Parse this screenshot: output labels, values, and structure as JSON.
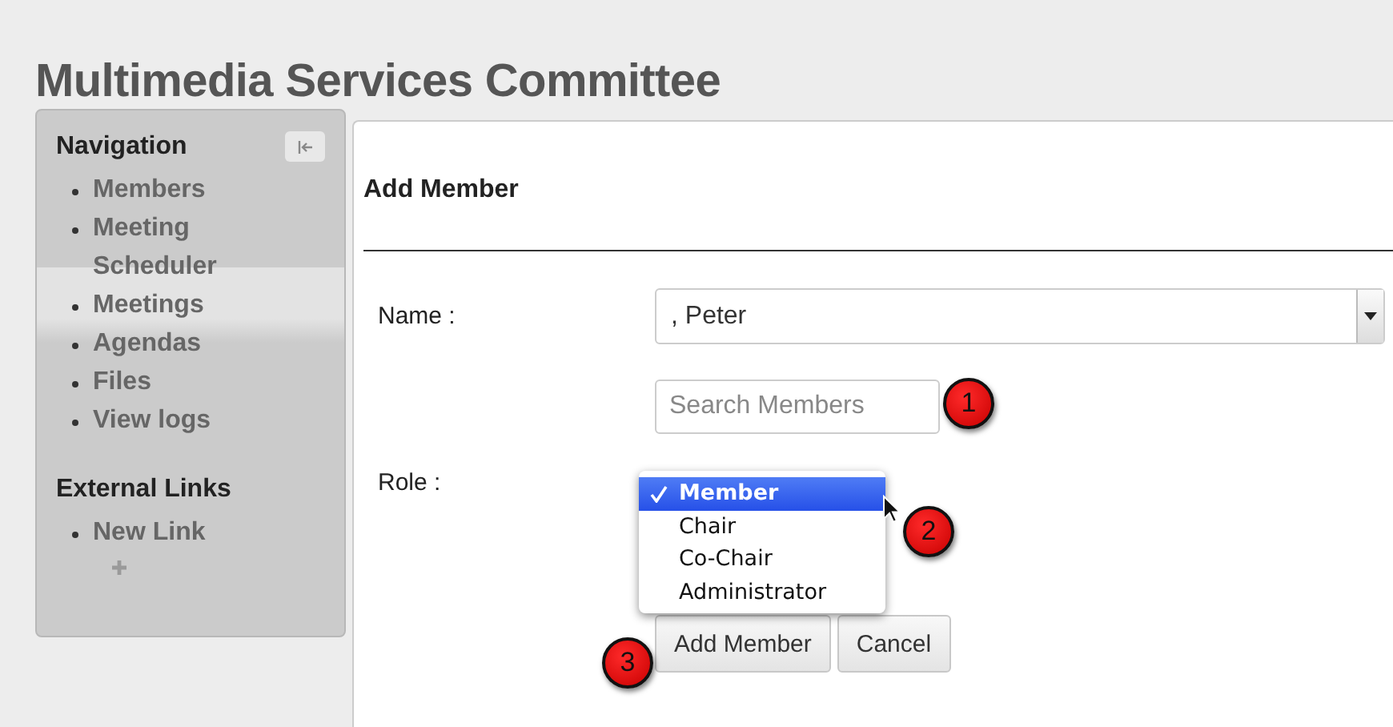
{
  "page_title": "Multimedia Services Committee",
  "sidebar": {
    "sections": [
      {
        "heading": "Navigation",
        "items": [
          "Members",
          "Meeting Scheduler",
          "Meetings",
          "Agendas",
          "Files",
          "View logs"
        ]
      },
      {
        "heading": "External Links",
        "items": [
          "New Link"
        ]
      }
    ]
  },
  "form": {
    "title": "Add Member",
    "name": {
      "label": "Name :",
      "value": ", Peter"
    },
    "search": {
      "placeholder": "Search Members"
    },
    "role": {
      "label": "Role :",
      "options": [
        {
          "label": "Member",
          "selected": true
        },
        {
          "label": "Chair",
          "selected": false
        },
        {
          "label": "Co-Chair",
          "selected": false
        },
        {
          "label": "Administrator",
          "selected": false
        }
      ]
    },
    "buttons": [
      "Add Member",
      "Cancel"
    ]
  },
  "callouts": [
    "1",
    "2",
    "3"
  ]
}
